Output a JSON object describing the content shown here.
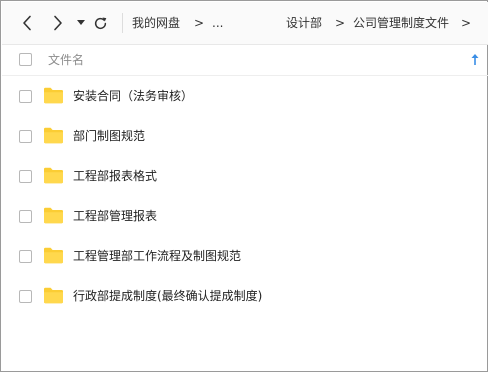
{
  "toolbar": {
    "back_icon": "chevron-left-icon",
    "forward_icon": "chevron-right-icon",
    "history_icon": "caret-down-icon",
    "refresh_icon": "refresh-icon"
  },
  "breadcrumb": {
    "items": [
      "我的网盘",
      "...",
      "设计部",
      "公司管理制度文件"
    ],
    "separator": ">"
  },
  "header": {
    "name_column": "文件名",
    "sort_icon": "arrow-up-icon"
  },
  "files": [
    {
      "name": "安装合同（法务审核）",
      "type": "folder"
    },
    {
      "name": "部门制图规范",
      "type": "folder"
    },
    {
      "name": "工程部报表格式",
      "type": "folder"
    },
    {
      "name": "工程部管理报表",
      "type": "folder"
    },
    {
      "name": "工程管理部工作流程及制图规范",
      "type": "folder"
    },
    {
      "name": "行政部提成制度(最终确认提成制度)",
      "type": "folder"
    }
  ],
  "colors": {
    "folder": "#fbcd34",
    "accent": "#3a8ee6",
    "toolbar_bg": "#fafafa"
  }
}
